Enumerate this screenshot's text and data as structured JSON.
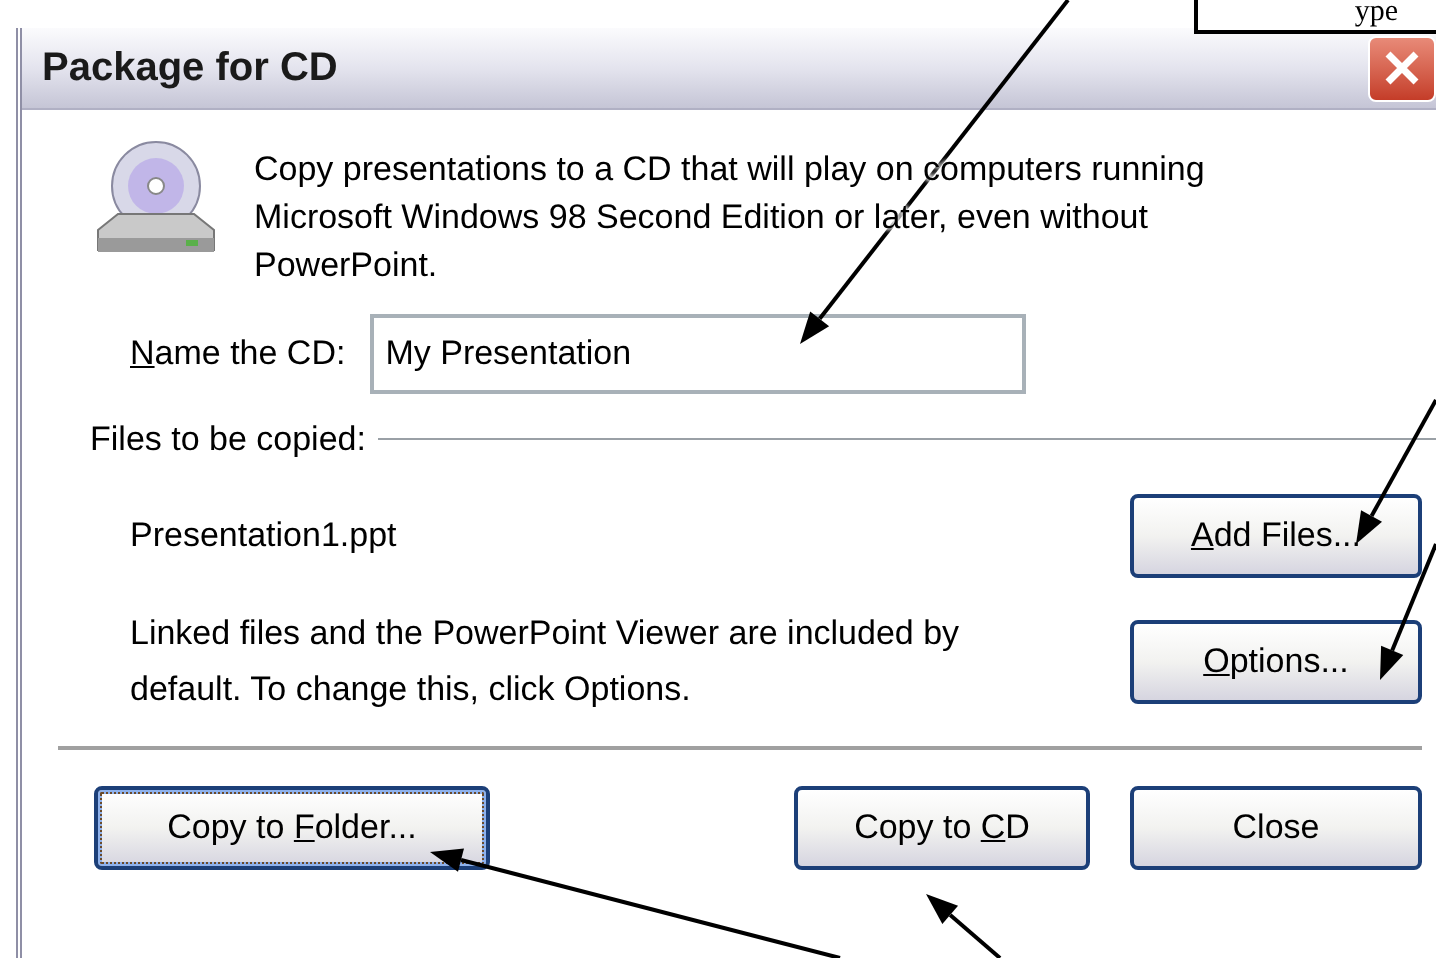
{
  "callout": {
    "text": "ype"
  },
  "window": {
    "title": "Package for CD"
  },
  "description": "Copy presentations to a CD that will play on computers running Microsoft Windows 98 Second Edition or later, even without PowerPoint.",
  "name_field": {
    "access_key": "N",
    "label_after": "ame the CD:",
    "value": "My Presentation"
  },
  "files_group": {
    "title": "Files to be copied:"
  },
  "files": [
    {
      "name": "Presentation1.ppt"
    }
  ],
  "add_files_button": {
    "access_key": "A",
    "label_after": "dd Files..."
  },
  "linked_note": "Linked files and the PowerPoint Viewer are included by default. To change this, click Options.",
  "options_button": {
    "access_key": "O",
    "label_after": "ptions..."
  },
  "buttons": [
    {
      "label_before": "Copy to ",
      "access_key": "F",
      "label_after": "older...",
      "focused": true
    },
    {
      "label_before": "Copy to ",
      "access_key": "C",
      "label_after": "D",
      "focused": false
    },
    {
      "label_after": "Close",
      "focused": false
    }
  ]
}
